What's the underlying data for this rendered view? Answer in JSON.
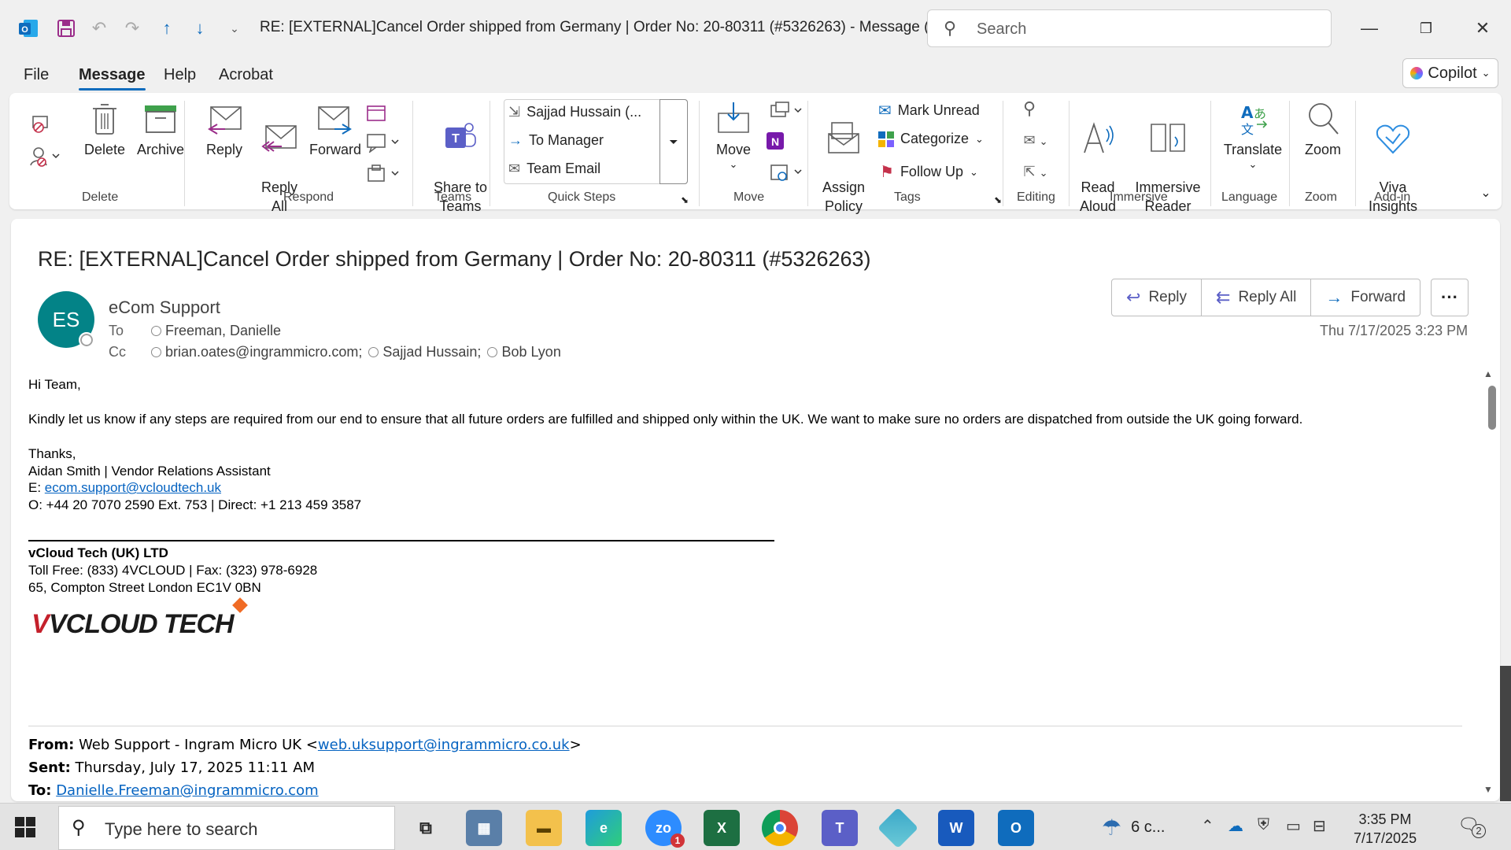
{
  "window": {
    "title": "RE: [EXTERNAL]Cancel Order shipped from Germany | Order No: 20-80311 (#5326263)  -  Message (...",
    "search_placeholder": "Search"
  },
  "menu": {
    "tabs": [
      "File",
      "Message",
      "Help",
      "Acrobat"
    ],
    "active_tab": "Message",
    "copilot_label": "Copilot"
  },
  "ribbon": {
    "delete_label": "Delete",
    "archive_label": "Archive",
    "reply_label": "Reply",
    "reply_all_label": "Reply\nAll",
    "forward_label": "Forward",
    "share_teams_label": "Share to\nTeams",
    "quick_steps": [
      "Sajjad Hussain (...",
      "To Manager",
      "Team Email"
    ],
    "move_label": "Move",
    "assign_policy_label": "Assign\nPolicy",
    "mark_unread_label": "Mark Unread",
    "categorize_label": "Categorize",
    "follow_up_label": "Follow Up",
    "read_aloud_label": "Read\nAloud",
    "immersive_reader_label": "Immersive\nReader",
    "translate_label": "Translate",
    "zoom_label": "Zoom",
    "viva_label": "Viva\nInsights",
    "groups": {
      "delete": "Delete",
      "respond": "Respond",
      "teams": "Teams",
      "quick_steps": "Quick Steps",
      "move": "Move",
      "tags": "Tags",
      "editing": "Editing",
      "immersive": "Immersive",
      "language": "Language",
      "zoom": "Zoom",
      "addin": "Add-in"
    }
  },
  "message": {
    "subject": "RE: [EXTERNAL]Cancel Order shipped from Germany | Order No: 20-80311 (#5326263)",
    "avatar_initials": "ES",
    "sender": "eCom Support",
    "to_label": "To",
    "to": [
      "Freeman, Danielle"
    ],
    "cc_label": "Cc",
    "cc": [
      "brian.oates@ingrammicro.com;",
      "Sajjad Hussain;",
      "Bob Lyon"
    ],
    "date": "Thu 7/17/2025 3:23 PM",
    "actions": {
      "reply": "Reply",
      "reply_all": "Reply All",
      "forward": "Forward"
    },
    "body": {
      "greeting": "Hi Team,",
      "paragraph": "Kindly let us know if any steps are required from our end to ensure that all future orders are fulfilled and shipped only within the UK. We want to make sure no orders are dispatched from outside the UK going forward.",
      "thanks": "Thanks,",
      "sig_name": "Aidan Smith | Vendor Relations Assistant",
      "sig_email_prefix": "E: ",
      "sig_email": "ecom.support@vcloudtech.uk",
      "sig_phone": "O:  +44 20 7070 2590 Ext. 753 | Direct: +1 213 459 3587",
      "company": "vCloud Tech (UK) LTD",
      "toll_free": "Toll Free: (833) 4VCLOUD | Fax: (323) 978-6928",
      "address": "65, Compton Street London EC1V 0BN",
      "logo_text": "VCLOUD TECH"
    },
    "forwarded": {
      "from_label": "From:",
      "from_name": " Web Support - Ingram Micro UK <",
      "from_email": "web.uksupport@ingrammicro.co.uk",
      "from_close": ">",
      "sent_label": "Sent:",
      "sent": " Thursday, July 17, 2025 11:11 AM",
      "to_label": "To:",
      "to_email": "Danielle.Freeman@ingrammicro.com"
    }
  },
  "taskbar": {
    "search_placeholder": "Type here to search",
    "weather": "6 c...",
    "time": "3:35 PM",
    "date": "7/17/2025",
    "notification_count": "2",
    "zoom_badge": "1"
  },
  "colors": {
    "accent": "#0f6cbd",
    "avatar_bg": "#038387",
    "link": "#0563c1"
  }
}
